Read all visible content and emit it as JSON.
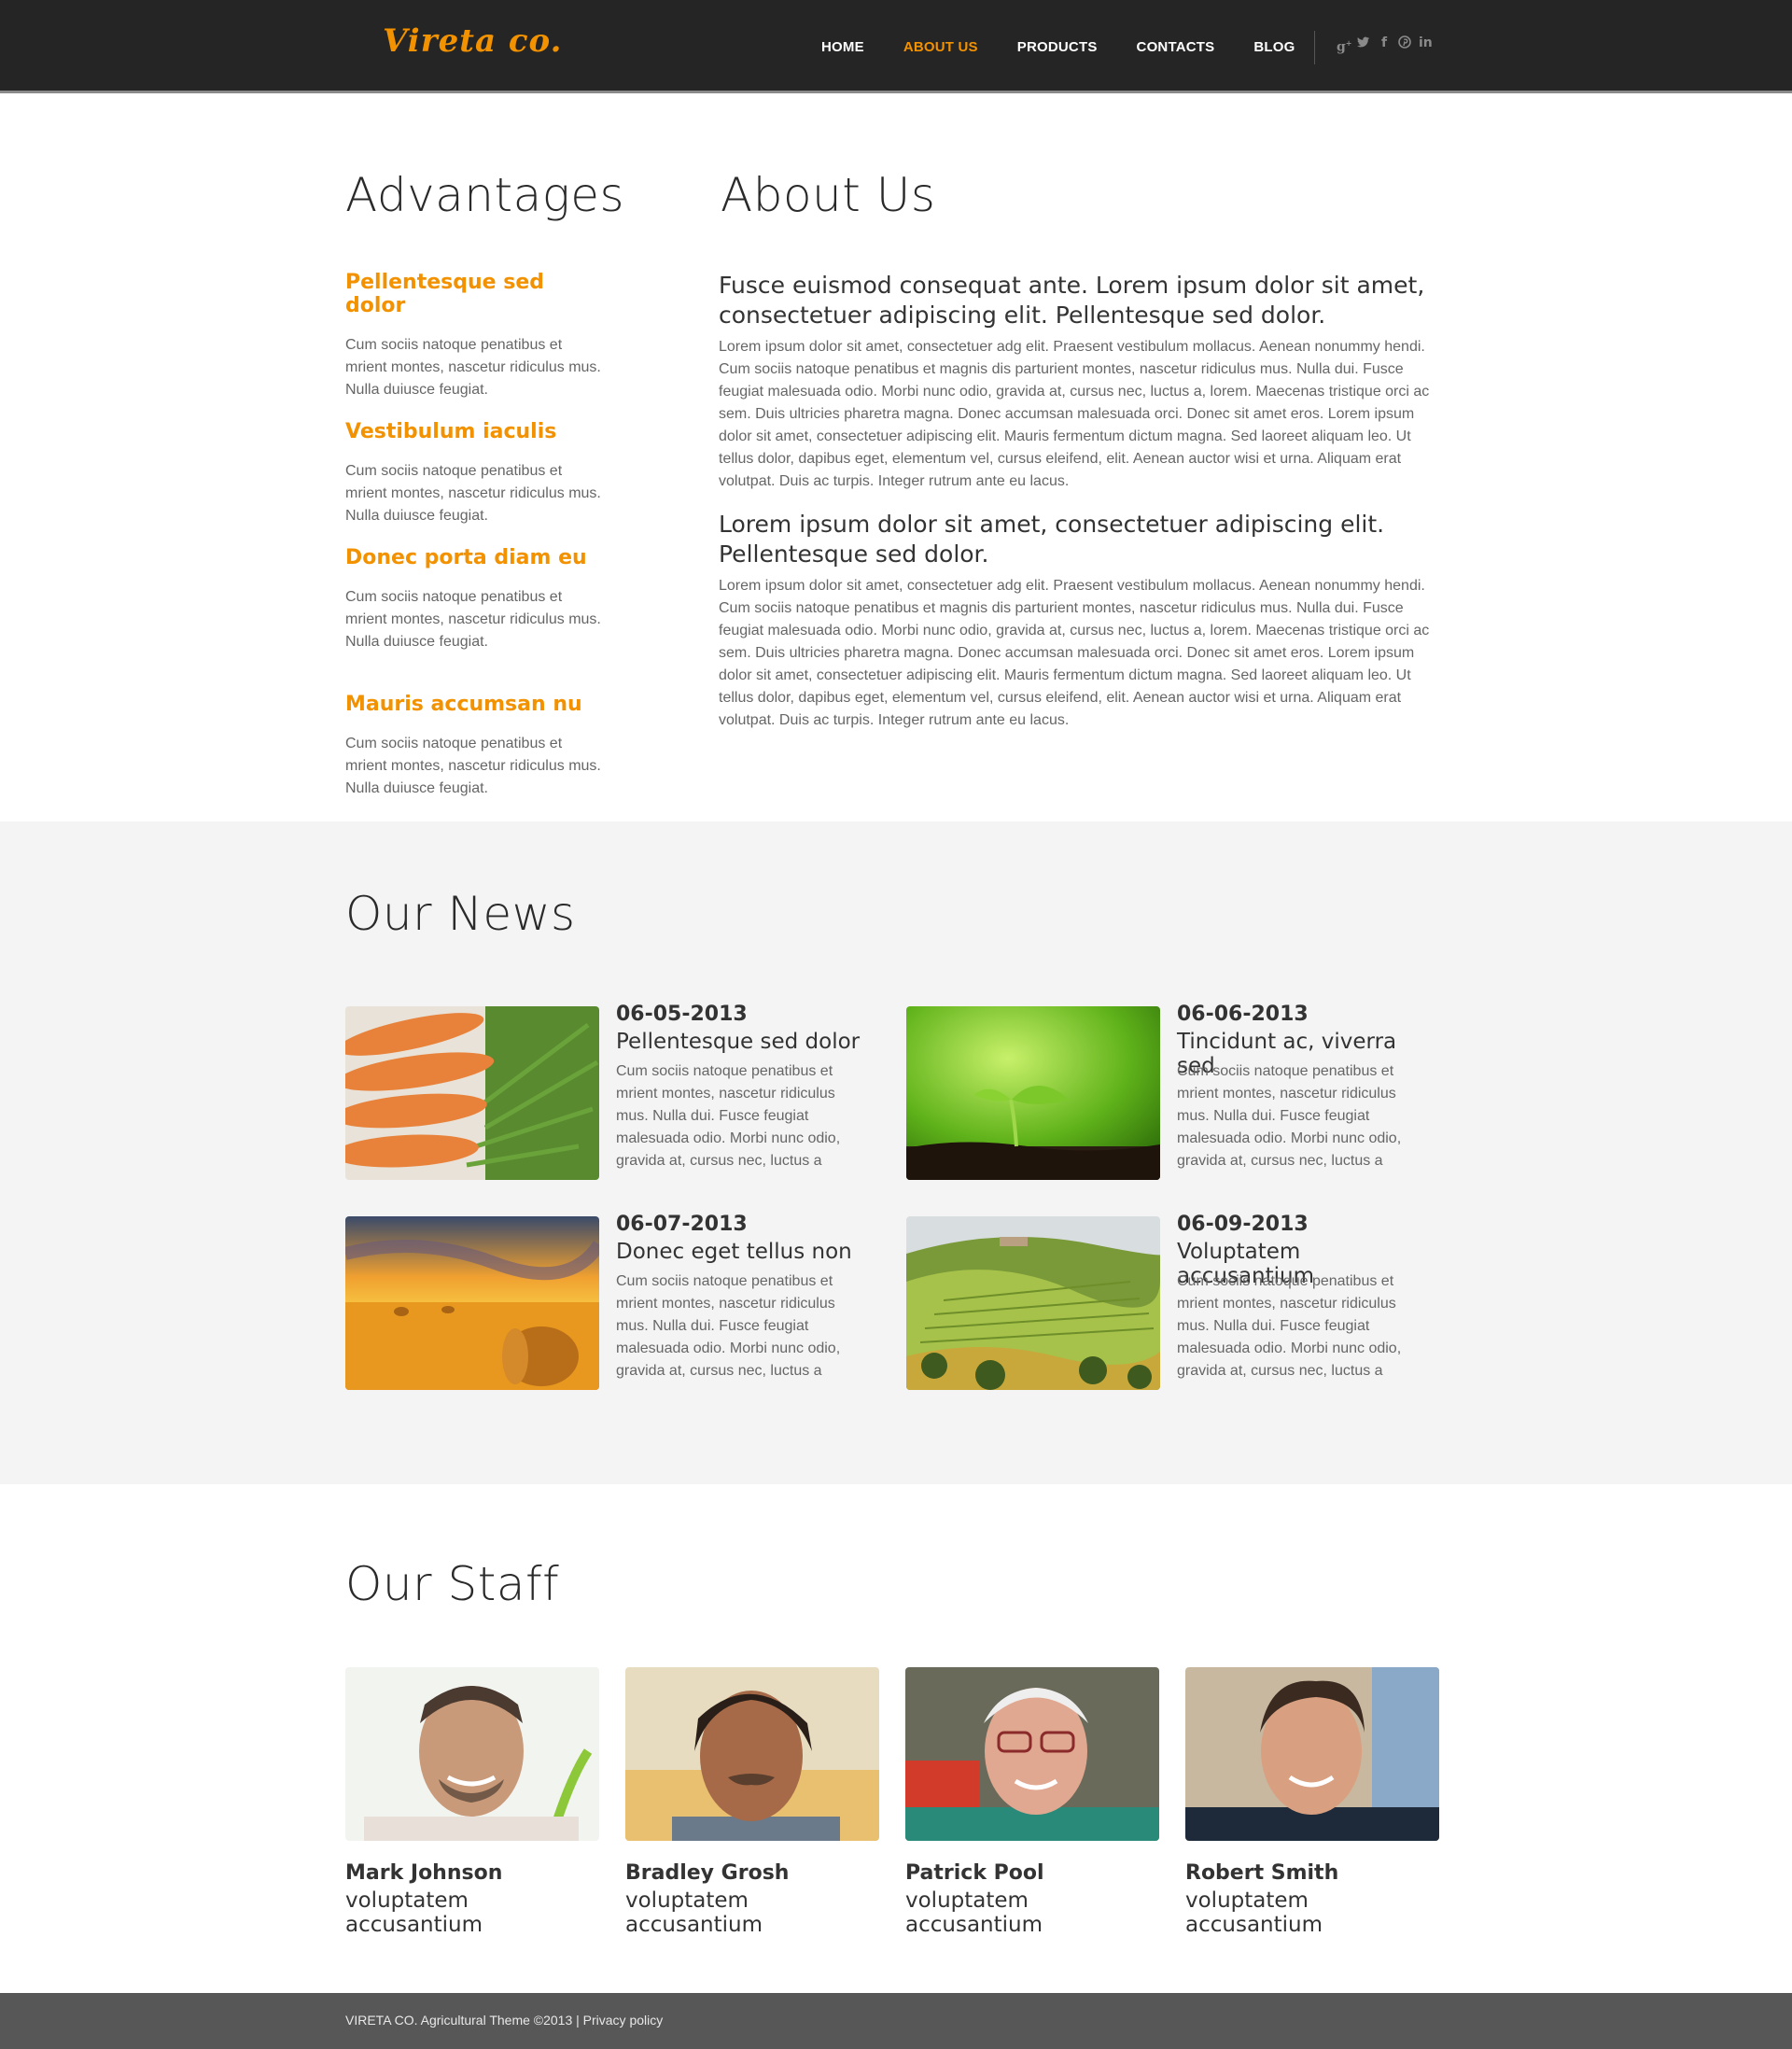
{
  "header": {
    "logo": "Vireta co.",
    "nav": [
      "HOME",
      "ABOUT US",
      "PRODUCTS",
      "CONTACTS",
      "BLOG"
    ],
    "active_nav": "ABOUT US",
    "social_icons": [
      "google-plus-icon",
      "twitter-icon",
      "facebook-icon",
      "pinterest-icon",
      "linkedin-icon"
    ],
    "accent_color": "#f39200"
  },
  "advantages": {
    "title": "Advantages",
    "items": [
      {
        "heading": "Pellentesque sed dolor",
        "text": "Cum sociis natoque penatibus et mrient montes, nascetur ridiculus mus. Nulla duiusce feugiat."
      },
      {
        "heading": "Vestibulum iaculis",
        "text": "Cum sociis natoque penatibus et mrient montes, nascetur ridiculus mus. Nulla duiusce feugiat."
      },
      {
        "heading": "Donec porta diam eu",
        "text": "Cum sociis natoque penatibus et mrient montes, nascetur ridiculus mus. Nulla duiusce feugiat."
      },
      {
        "heading": "Mauris accumsan nu",
        "text": "Cum sociis natoque penatibus et mrient montes, nascetur ridiculus mus. Nulla duiusce feugiat."
      }
    ]
  },
  "about": {
    "title": "About Us",
    "blocks": [
      {
        "lead": "Fusce euismod consequat ante. Lorem ipsum dolor sit amet, consectetuer adipiscing elit. Pellentesque sed dolor.",
        "text": "Lorem ipsum dolor sit amet, consectetuer adg elit. Praesent vestibulum mollacus. Aenean nonummy hendi. Cum sociis natoque penatibus et magnis dis parturient montes, nascetur ridiculus mus. Nulla dui. Fusce feugiat malesuada odio. Morbi nunc odio, gravida at, cursus nec, luctus a, lorem. Maecenas tristique orci ac sem. Duis ultricies pharetra magna. Donec accumsan malesuada orci. Donec sit amet eros. Lorem ipsum dolor sit amet, consectetuer adipiscing elit. Mauris fermentum dictum magna. Sed laoreet aliquam leo. Ut tellus dolor, dapibus eget, elementum vel, cursus eleifend, elit. Aenean auctor wisi et urna. Aliquam erat volutpat. Duis ac turpis. Integer rutrum ante eu lacus."
      },
      {
        "lead": "Lorem ipsum dolor sit amet, consectetuer adipiscing elit. Pellentesque sed dolor.",
        "text": "Lorem ipsum dolor sit amet, consectetuer adg elit. Praesent vestibulum mollacus. Aenean nonummy hendi. Cum sociis natoque penatibus et magnis dis parturient montes, nascetur ridiculus mus. Nulla dui. Fusce feugiat malesuada odio. Morbi nunc odio, gravida at, cursus nec, luctus a, lorem. Maecenas tristique orci ac sem. Duis ultricies pharetra magna. Donec accumsan malesuada orci. Donec sit amet eros. Lorem ipsum dolor sit amet, consectetuer adipiscing elit. Mauris fermentum dictum magna. Sed laoreet aliquam leo. Ut tellus dolor, dapibus eget, elementum vel, cursus eleifend, elit. Aenean auctor wisi et urna. Aliquam erat volutpat. Duis ac turpis. Integer rutrum ante eu lacus."
      }
    ]
  },
  "news": {
    "title": "Our News",
    "items": [
      {
        "date": "06-05-2013",
        "heading": "Pellentesque sed dolor",
        "text": "Cum sociis natoque penatibus et mrient montes, nascetur ridiculus mus. Nulla dui. Fusce feugiat malesuada odio. Morbi nunc odio, gravida at, cursus nec, luctus a",
        "image": "carrots-photo"
      },
      {
        "date": "06-06-2013",
        "heading": "Tincidunt ac, viverra sed",
        "text": "Cum sociis natoque penatibus et mrient montes, nascetur ridiculus mus. Nulla dui. Fusce feugiat malesuada odio. Morbi nunc odio, gravida at, cursus nec, luctus a",
        "image": "sprout-photo"
      },
      {
        "date": "06-07-2013",
        "heading": "Donec eget tellus non",
        "text": "Cum sociis natoque penatibus et mrient montes, nascetur ridiculus mus. Nulla dui. Fusce feugiat malesuada odio. Morbi nunc odio, gravida at, cursus nec, luctus a",
        "image": "hay-field-photo"
      },
      {
        "date": "06-09-2013",
        "heading": "Voluptatem accusantium",
        "text": "Cum sociis natoque penatibus et mrient montes, nascetur ridiculus mus. Nulla dui. Fusce feugiat malesuada odio. Morbi nunc odio, gravida at, cursus nec, luctus a",
        "image": "vineyard-hills-photo"
      }
    ]
  },
  "staff": {
    "title": "Our Staff",
    "members": [
      {
        "name": "Mark Johnson",
        "role": "voluptatem accusantium"
      },
      {
        "name": "Bradley Grosh",
        "role": "voluptatem accusantium"
      },
      {
        "name": "Patrick Pool",
        "role": "voluptatem accusantium"
      },
      {
        "name": "Robert Smith",
        "role": "voluptatem accusantium"
      }
    ]
  },
  "footer": {
    "text": "VIRETA CO. Agricultural Theme ©2013 |",
    "privacy": "Privacy policy"
  }
}
